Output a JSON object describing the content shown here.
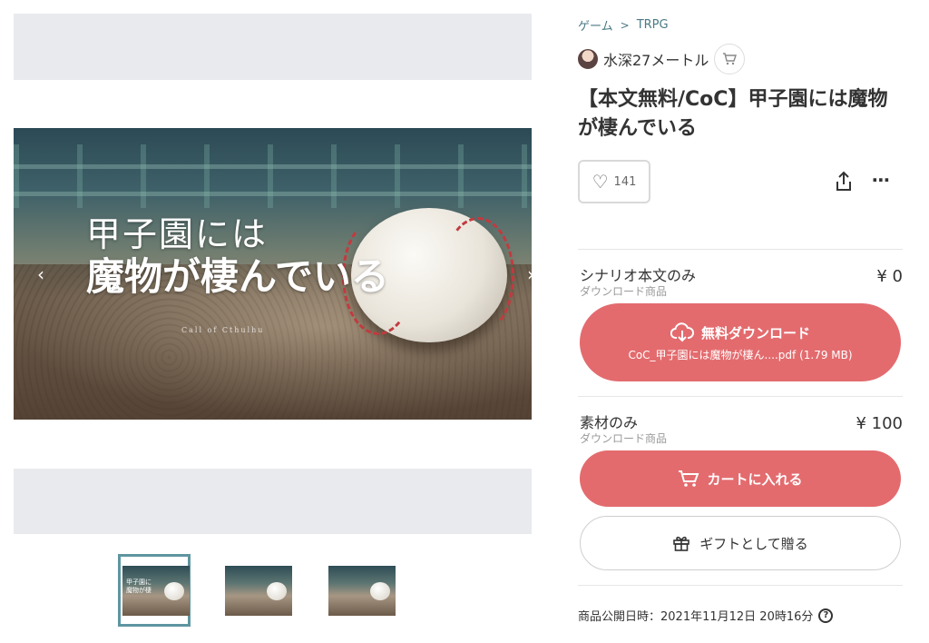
{
  "breadcrumb": {
    "category": "ゲーム",
    "subcategory": "TRPG"
  },
  "shop": {
    "name": "水深27メートル"
  },
  "product": {
    "title": "【本文無料/CoC】甲子園には魔物が棲んでいる",
    "likes": "141"
  },
  "image": {
    "title_line1": "甲子園には",
    "title_line2": "魔物が棲んでいる",
    "subtitle": "Call of Cthulhu"
  },
  "thumbnail": {
    "text": "甲子園に魔物が棲"
  },
  "variants": [
    {
      "name": "シナリオ本文のみ",
      "type": "ダウンロード商品",
      "price": "¥ 0",
      "button_label": "無料ダウンロード",
      "file": "CoC_甲子園には魔物が棲ん....pdf (1.79 MB)"
    },
    {
      "name": "素材のみ",
      "type": "ダウンロード商品",
      "price": "¥ 100",
      "button_label": "カートに入れる"
    }
  ],
  "gift_label": "ギフトとして贈る",
  "published": "商品公開日時：2021年11月12日 20時16分",
  "icons": {
    "breadcrumb_separator": "chevron-right-icon",
    "shop_cart": "cart-icon",
    "like": "heart-icon",
    "share": "share-icon",
    "more": "more-icon",
    "download": "cloud-download-icon",
    "cart_button": "cart-icon",
    "gift": "gift-icon",
    "help": "help-icon",
    "prev": "chevron-left-icon",
    "next": "chevron-right-icon"
  },
  "colors": {
    "accent": "#e36b6e",
    "link": "#4a7a86",
    "thumb_border": "#5e95a0"
  }
}
